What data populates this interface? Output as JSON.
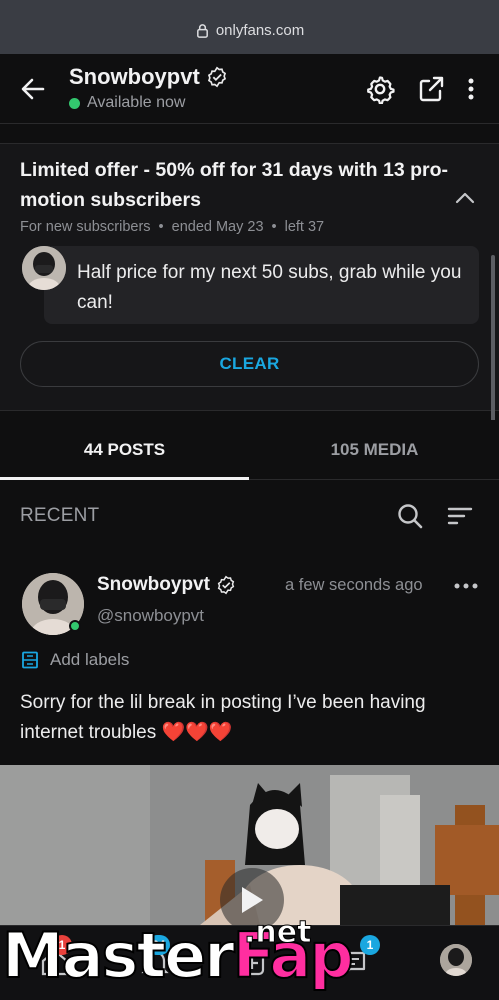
{
  "browser": {
    "url": "onlyfans.com"
  },
  "header": {
    "name": "Snowboypvt",
    "status": "Available now"
  },
  "promo": {
    "title": "Limited offer - 50% off for 31 days with 13 pro-motion subscribers",
    "meta": [
      "For new subscribers",
      "ended May 23",
      "left 37"
    ],
    "message": "Half price for my next 50 subs, grab while you can!",
    "clear_label": "CLEAR"
  },
  "tabs": [
    {
      "label": "44 POSTS",
      "active": true
    },
    {
      "label": "105 MEDIA",
      "active": false
    }
  ],
  "feed": {
    "section_label": "RECENT"
  },
  "post": {
    "name": "Snowboypvt",
    "handle": "@snowboypvt",
    "time": "a few seconds ago",
    "labels_label": "Add labels",
    "text": "Sorry for the lil break in posting I’ve been having internet troubles ❤️❤️❤️"
  },
  "bottom_nav": {
    "badges": {
      "home": "1",
      "notifications": "24",
      "messages": "1"
    }
  },
  "watermark": {
    "brand_a": "Master",
    "brand_b": "Fap",
    "suffix": ".net"
  },
  "colors": {
    "accent": "#1aa7e0",
    "online": "#33c76e",
    "badge_red": "#e8413c",
    "badge_blue": "#1aa7e0"
  }
}
